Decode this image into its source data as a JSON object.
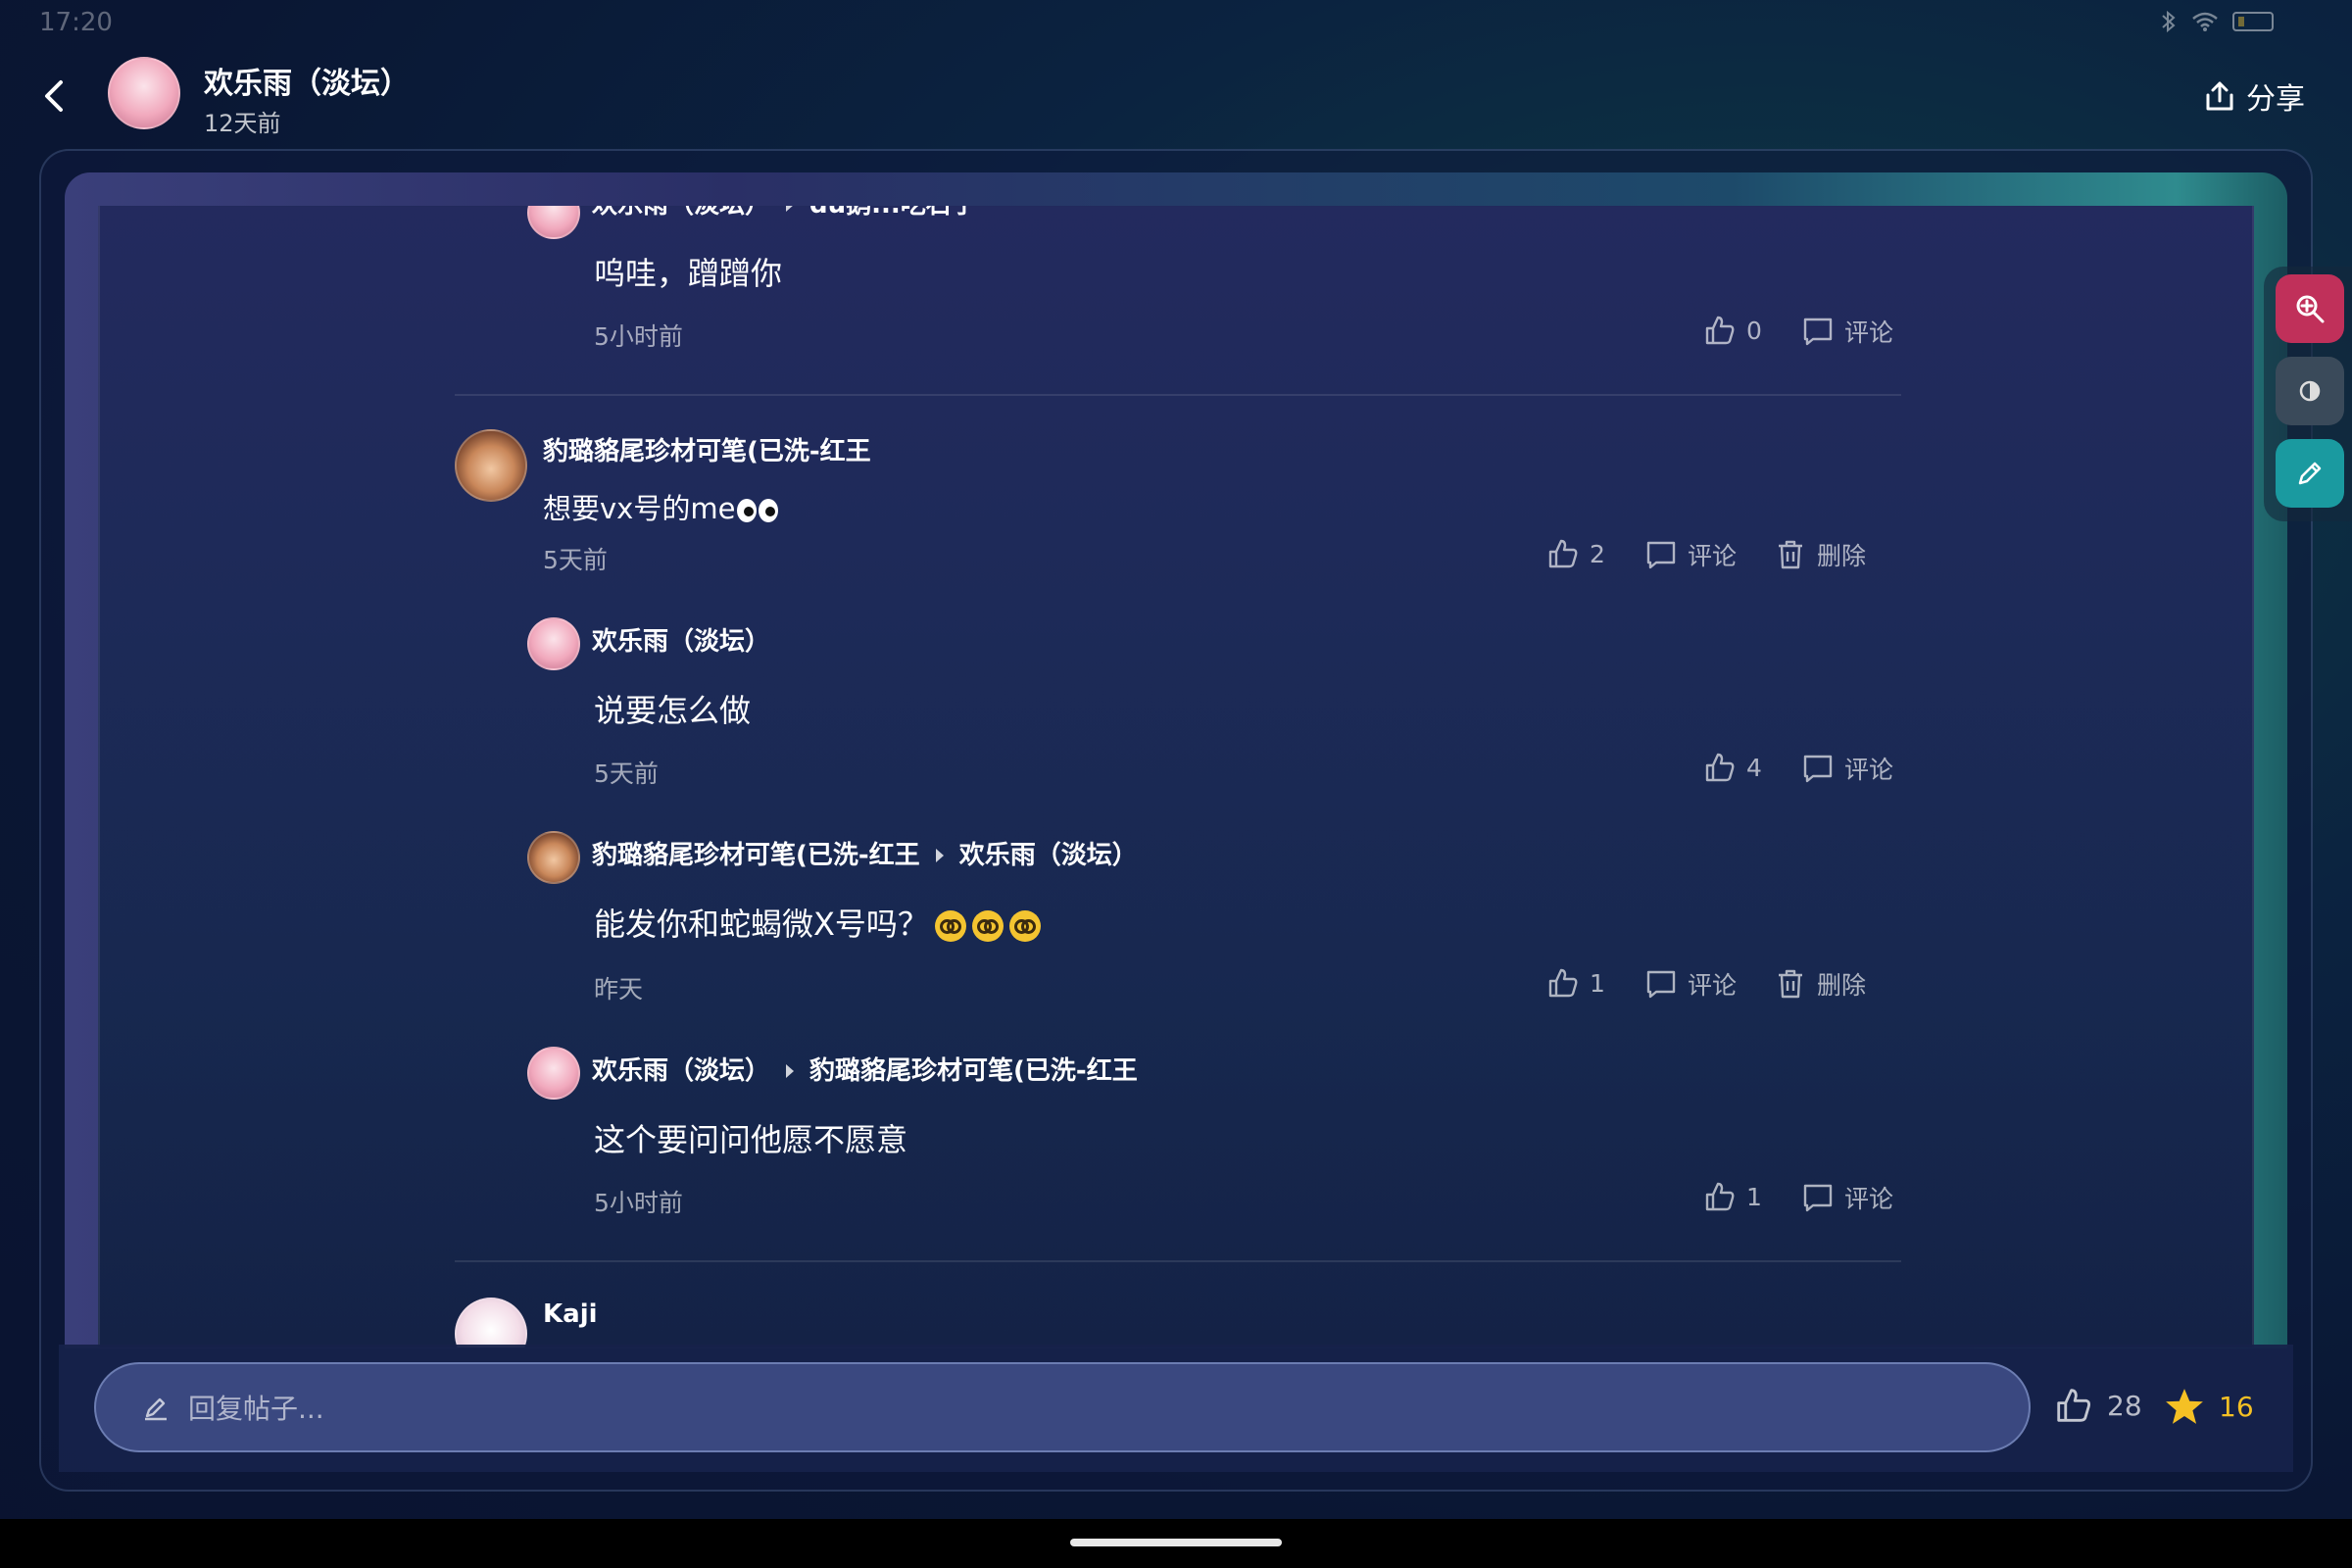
{
  "status_bar": {
    "time": "17:20"
  },
  "header": {
    "author": "欢乐雨（淡坛）",
    "time": "12天前",
    "share_label": "分享"
  },
  "comments": [
    {
      "id": "c1",
      "author": "欢乐雨（淡坛）",
      "reply_to": "du鹅...吃石子",
      "text": "呜哇，蹭蹭你",
      "time": "5小时前",
      "likes": "0",
      "comment_label": "评论"
    },
    {
      "id": "c2",
      "author": "豹璐貉尾珍材可笔(已洗-红王",
      "text": "想要vx号的me",
      "time": "5天前",
      "likes": "2",
      "comment_label": "评论",
      "delete_label": "删除"
    },
    {
      "id": "c3",
      "author": "欢乐雨（淡坛）",
      "text": "说要怎么做",
      "time": "5天前",
      "likes": "4",
      "comment_label": "评论"
    },
    {
      "id": "c4",
      "author": "豹璐貉尾珍材可笔(已洗-红王",
      "reply_to": "欢乐雨（淡坛）",
      "text": "能发你和蛇蝎微X号吗？",
      "time": "昨天",
      "likes": "1",
      "comment_label": "评论",
      "delete_label": "删除"
    },
    {
      "id": "c5",
      "author": "欢乐雨（淡坛）",
      "reply_to": "豹璐貉尾珍材可笔(已洗-红王",
      "text": "这个要问问他愿不愿意",
      "time": "5小时前",
      "likes": "1",
      "comment_label": "评论"
    },
    {
      "id": "c6",
      "author": "Kaji"
    }
  ],
  "side_tools": [
    {
      "name": "zoom-in-icon",
      "color": "#c0305a"
    },
    {
      "name": "contrast-icon",
      "color": "#3a4a5a"
    },
    {
      "name": "pen-icon",
      "color": "#1a9aa0"
    }
  ],
  "bottom_bar": {
    "reply_placeholder": "回复帖子...",
    "like_count": "28",
    "star_count": "16"
  }
}
